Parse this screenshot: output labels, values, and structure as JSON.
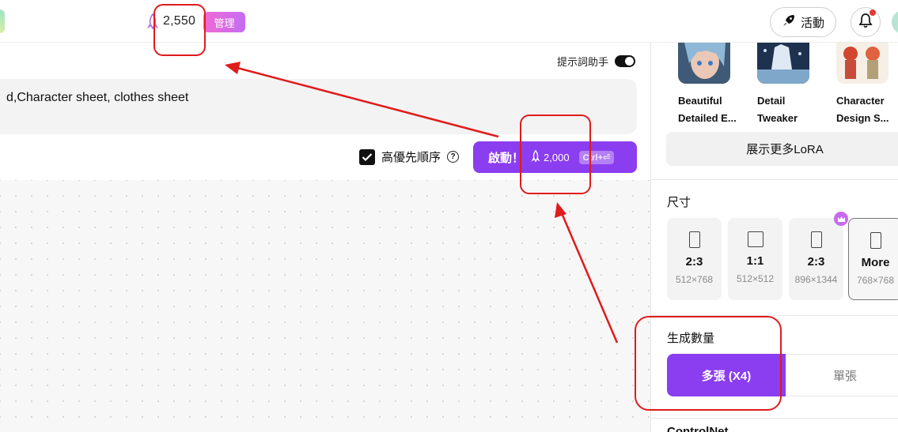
{
  "header": {
    "credits": "2,550",
    "manage_label": "管理",
    "activity_label": "活動"
  },
  "main": {
    "assistant_label": "提示詞助手",
    "prompt_text": "d,Character sheet, clothes sheet",
    "priority_label": "高優先順序",
    "start_label": "啟動！",
    "start_cost": "2,000",
    "shortcut": "Ctrl+⏎"
  },
  "sidebar": {
    "loras": [
      {
        "name": "Beautiful Detailed E..."
      },
      {
        "name": "Detail Tweaker LoRA"
      },
      {
        "name": "Character Design S..."
      }
    ],
    "more_lora_label": "展示更多LoRA",
    "size_title": "尺寸",
    "sizes": [
      {
        "label": "2:3",
        "dims": "512×768"
      },
      {
        "label": "1:1",
        "dims": "512×512"
      },
      {
        "label": "2:3",
        "dims": "896×1344"
      },
      {
        "label": "More",
        "dims": "768×768"
      }
    ],
    "count_title": "生成數量",
    "count_multi": "多張 (X4)",
    "count_single": "單張",
    "next_section": "ControlNet"
  },
  "colors": {
    "accent": "#8b3df0",
    "annotation": "#e01b1b"
  }
}
